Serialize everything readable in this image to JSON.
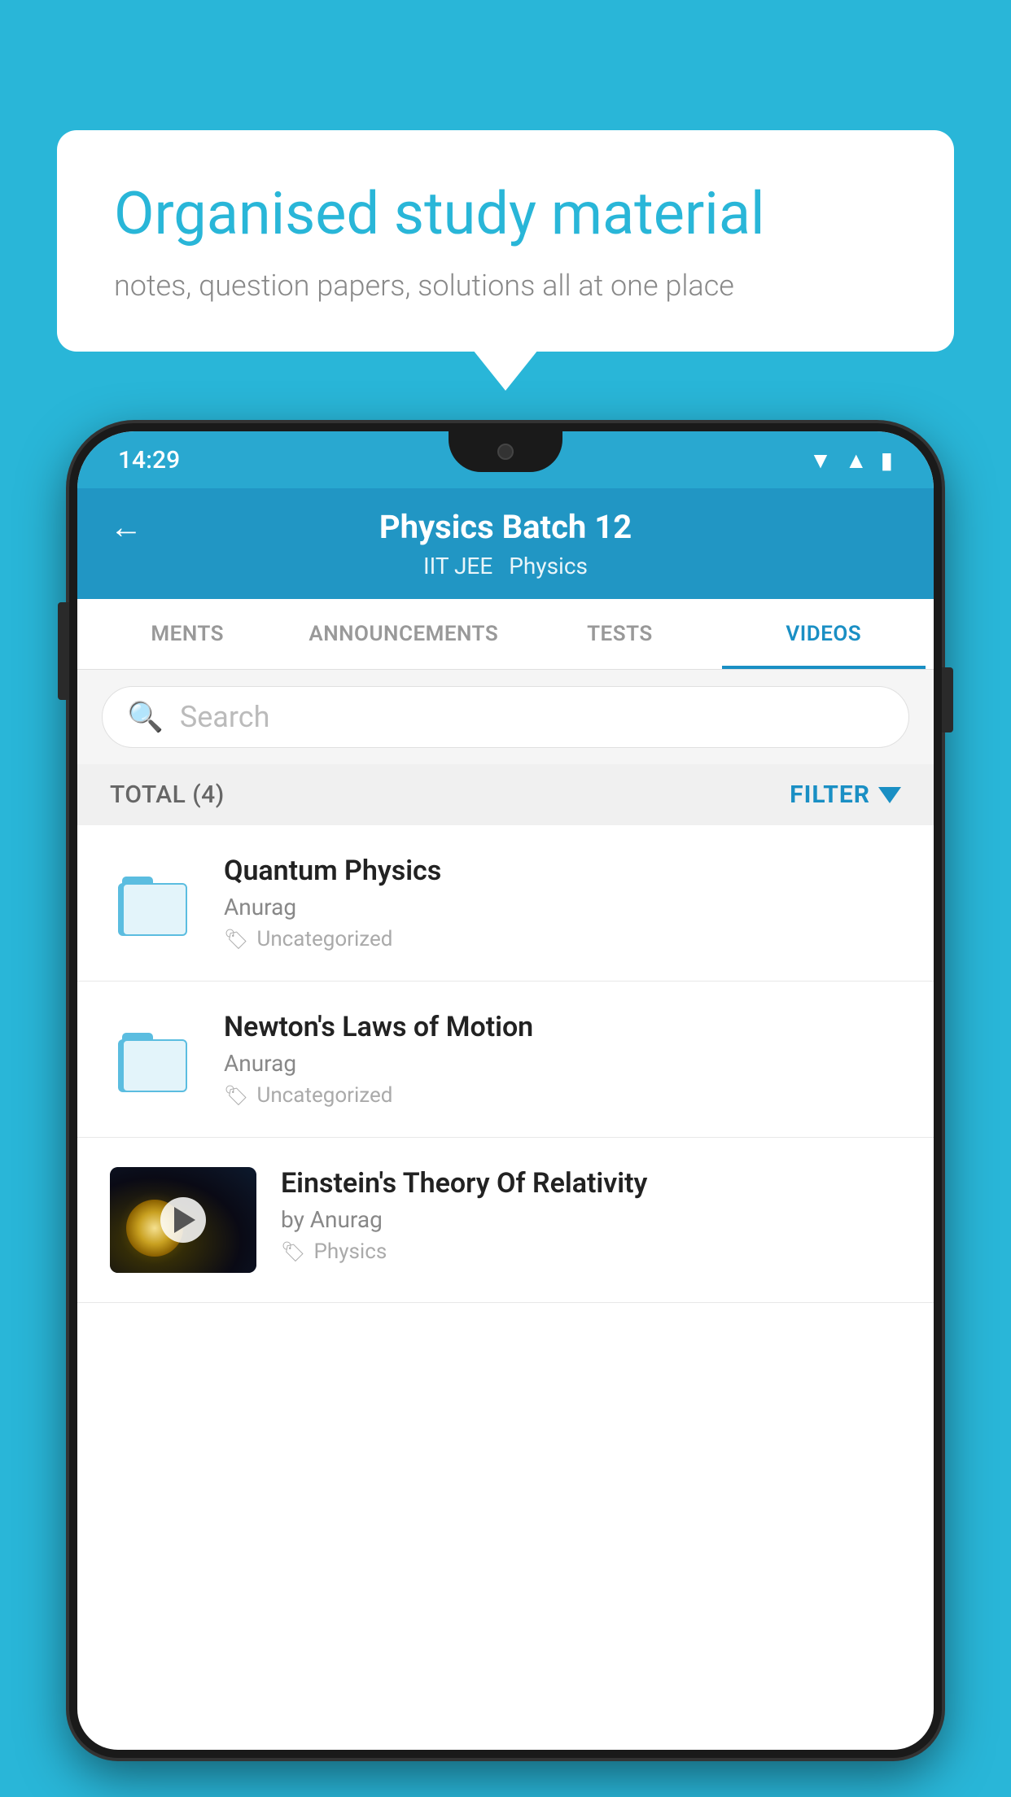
{
  "background": {
    "color": "#29b6d8"
  },
  "bubble": {
    "title": "Organised study material",
    "subtitle": "notes, question papers, solutions all at one place"
  },
  "phone": {
    "status_bar": {
      "time": "14:29"
    },
    "header": {
      "title": "Physics Batch 12",
      "tag1": "IIT JEE",
      "tag2": "Physics",
      "back_label": "←"
    },
    "tabs": [
      {
        "label": "MENTS",
        "active": false
      },
      {
        "label": "ANNOUNCEMENTS",
        "active": false
      },
      {
        "label": "TESTS",
        "active": false
      },
      {
        "label": "VIDEOS",
        "active": true
      }
    ],
    "search": {
      "placeholder": "Search"
    },
    "filter": {
      "total_label": "TOTAL (4)",
      "filter_label": "FILTER"
    },
    "videos": [
      {
        "title": "Quantum Physics",
        "author": "Anurag",
        "tag": "Uncategorized",
        "type": "folder"
      },
      {
        "title": "Newton's Laws of Motion",
        "author": "Anurag",
        "tag": "Uncategorized",
        "type": "folder"
      },
      {
        "title": "Einstein's Theory Of Relativity",
        "author": "by Anurag",
        "tag": "Physics",
        "type": "video"
      }
    ]
  }
}
